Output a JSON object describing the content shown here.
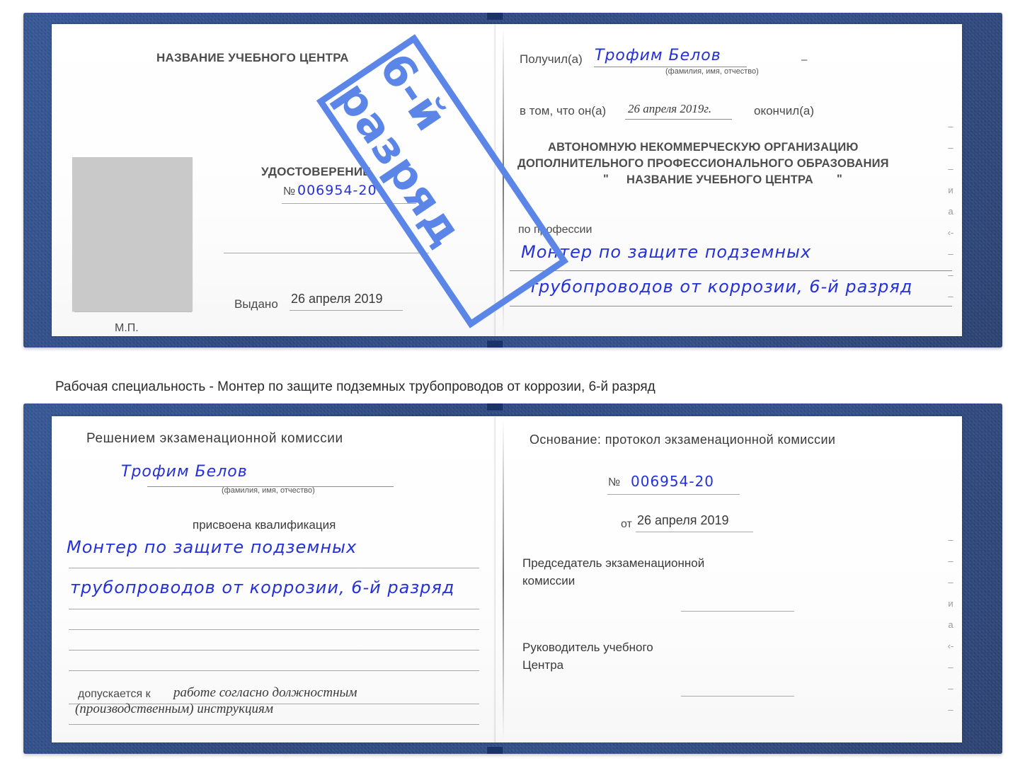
{
  "caption": "Рабочая специальность - Монтер по защите подземных трубопроводов от коррозии, 6-й разряд",
  "watermark": {
    "text": "6-й разряд"
  },
  "certificate_top": {
    "left_page": {
      "center_name": "НАЗВАНИЕ УЧЕБНОГО ЦЕНТРА",
      "doc_title": "УДОСТОВЕРЕНИЕ",
      "number_label": "№",
      "number_value": "006954-20",
      "issued_label": "Выдано",
      "issued_value": "26 апреля 2019",
      "stamp_label": "М.П.",
      "photo_placeholder": "photo"
    },
    "right_page": {
      "received_label": "Получил(а)",
      "received_value": "Трофим Белов",
      "name_hint": "(фамилия, имя, отчество)",
      "dash_mark": "–",
      "in_that_label": "в том, что он(а)",
      "in_that_value": "26 апреля 2019г.",
      "finished_label": "окончил(а)",
      "org_line1": "АВТОНОМНУЮ НЕКОММЕРЧЕСКУЮ ОРГАНИЗАЦИЮ",
      "org_line2": "ДОПОЛНИТЕЛЬНОГО ПРОФЕССИОНАЛЬНОГО ОБРАЗОВАНИЯ",
      "org_quote_open": "\"",
      "org_line3": "НАЗВАНИЕ УЧЕБНОГО ЦЕНТРА",
      "org_quote_close": "\"",
      "profession_label": "по профессии",
      "profession_line1": "Монтер по защите подземных",
      "profession_line2": "трубопроводов от коррозии, 6-й разряд",
      "bleed_glyphs": [
        "–",
        "–",
        "–",
        "и",
        "а",
        "‹-",
        "–",
        "–",
        "–"
      ]
    }
  },
  "certificate_bottom": {
    "left_page": {
      "heading": "Решением экзаменационной комиссии",
      "name_value": "Трофим Белов",
      "name_hint": "(фамилия, имя, отчество)",
      "qualification_label": "присвоена квалификация",
      "qualification_line1": "Монтер по защите подземных",
      "qualification_line2": "трубопроводов от коррозии, 6-й разряд",
      "admitted_label": "допускается к",
      "admitted_value_line1": "работе согласно должностным",
      "admitted_value_line2": "(производственным) инструкциям"
    },
    "right_page": {
      "basis_label": "Основание: протокол экзаменационной комиссии",
      "number_label": "№",
      "number_value": "006954-20",
      "date_label": "от",
      "date_value": "26 апреля 2019",
      "chairman_line1": "Председатель экзаменационной",
      "chairman_line2": "комиссии",
      "head_line1": "Руководитель учебного",
      "head_line2": "Центра",
      "bleed_glyphs": [
        "–",
        "–",
        "–",
        "и",
        "а",
        "‹-",
        "–",
        "–",
        "–"
      ]
    }
  },
  "colors": {
    "cover_blue": "#1e3e80",
    "handwriting_blue": "#2430d8",
    "watermark_blue": "#5b86e8",
    "photo_gray": "#c9c9c9",
    "rule_gray": "#a8a8a8"
  }
}
